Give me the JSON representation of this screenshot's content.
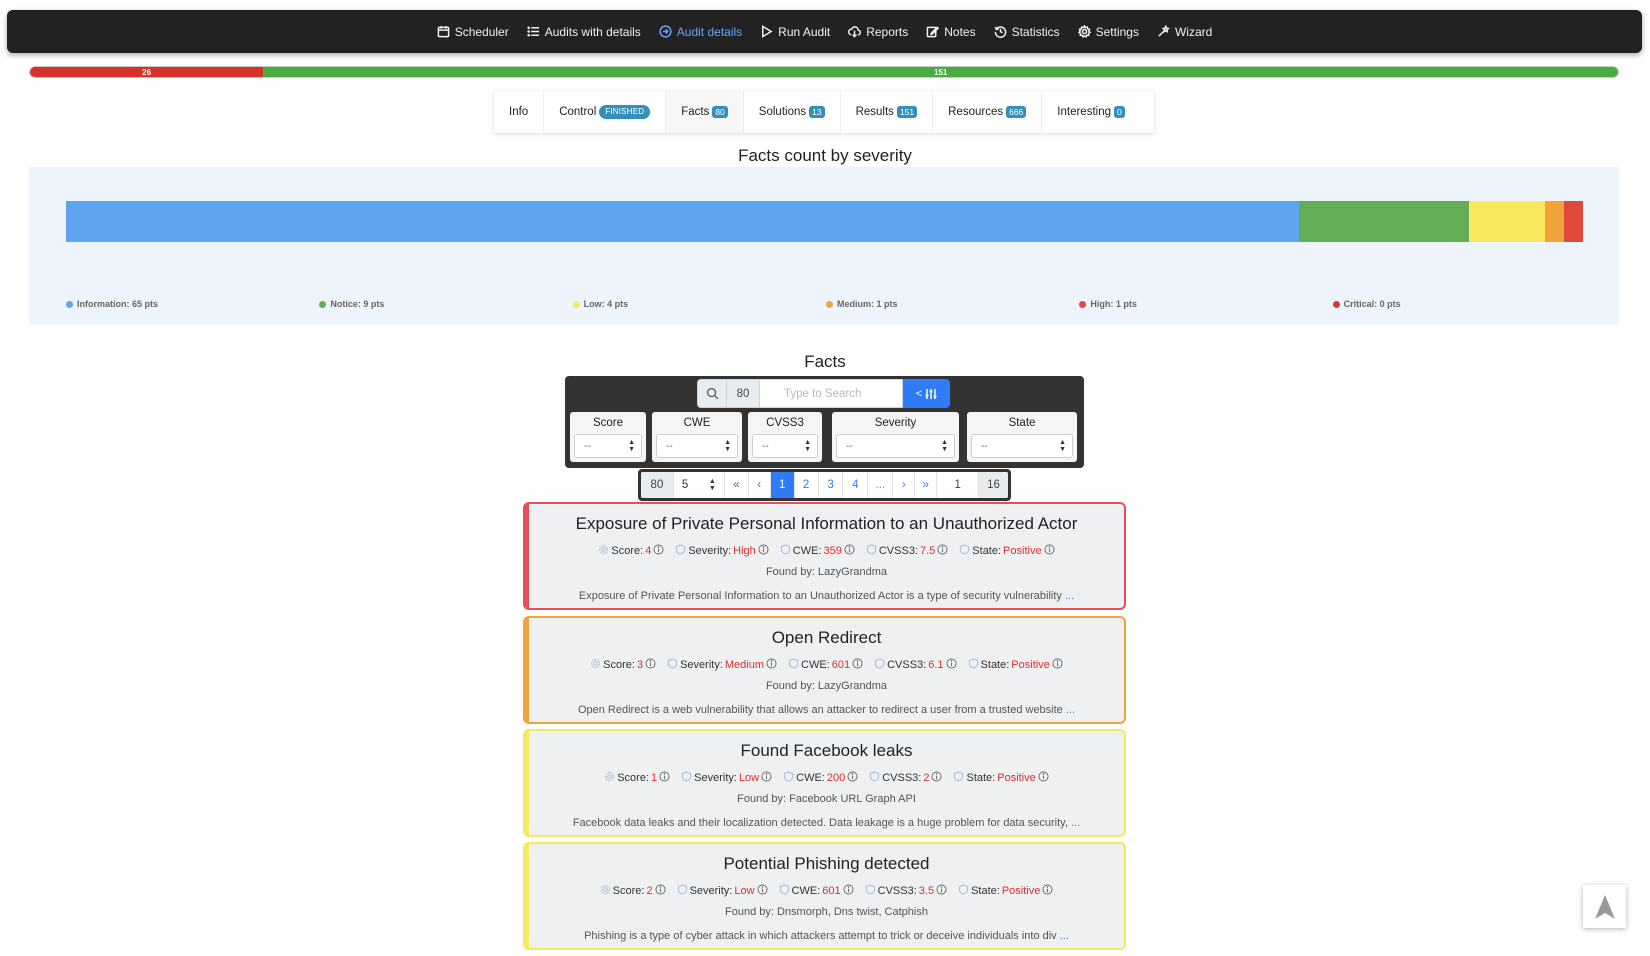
{
  "nav": [
    {
      "label": "Scheduler",
      "icon": "calendar-icon",
      "active": false
    },
    {
      "label": "Audits with details",
      "icon": "list-icon",
      "active": false
    },
    {
      "label": "Audit details",
      "icon": "arrow-circle-icon",
      "active": true
    },
    {
      "label": "Run Audit",
      "icon": "play-icon",
      "active": false
    },
    {
      "label": "Reports",
      "icon": "cloud-download-icon",
      "active": false
    },
    {
      "label": "Notes",
      "icon": "edit-icon",
      "active": false
    },
    {
      "label": "Statistics",
      "icon": "history-icon",
      "active": false
    },
    {
      "label": "Settings",
      "icon": "gear-icon",
      "active": false
    },
    {
      "label": "Wizard",
      "icon": "wand-icon",
      "active": false
    }
  ],
  "progress": {
    "segments": [
      {
        "label": "26",
        "value": 26,
        "color": "#d9302c"
      },
      {
        "label": "151",
        "value": 151,
        "color": "#4aab3f"
      }
    ]
  },
  "tabs": [
    {
      "label": "Info",
      "badge": "",
      "active": false
    },
    {
      "label": "Control",
      "badge": "FINISHED",
      "pill": true,
      "active": false
    },
    {
      "label": "Facts",
      "badge": "80",
      "active": true
    },
    {
      "label": "Solutions",
      "badge": "13",
      "active": false
    },
    {
      "label": "Results",
      "badge": "151",
      "active": false
    },
    {
      "label": "Resources",
      "badge": "666",
      "active": false
    },
    {
      "label": "Interesting",
      "badge": "0",
      "active": false
    }
  ],
  "chart_data": {
    "type": "bar",
    "title": "Facts count by severity",
    "orientation": "horizontal-stacked",
    "categories": [
      "Information",
      "Notice",
      "Low",
      "Medium",
      "High",
      "Critical"
    ],
    "values": [
      65,
      9,
      4,
      1,
      1,
      0
    ],
    "colors": [
      "#5ea3ee",
      "#62ad56",
      "#f7e85c",
      "#f0a33a",
      "#e0473d",
      "#cf3a33"
    ],
    "legend": [
      {
        "label": "Information: 65 pts"
      },
      {
        "label": "Notice: 9 pts"
      },
      {
        "label": "Low: 4 pts"
      },
      {
        "label": "Medium: 1 pts"
      },
      {
        "label": "High: 1 pts"
      },
      {
        "label": "Critical: 0 pts"
      }
    ],
    "legend_position": "bottom"
  },
  "facts": {
    "title": "Facts",
    "count": "80",
    "search_placeholder": "Type to Search",
    "toggle_label": "<",
    "filters": [
      {
        "label": "Score",
        "value": "--"
      },
      {
        "label": "CWE",
        "value": "--"
      },
      {
        "label": "CVSS3",
        "value": "--"
      },
      {
        "label": "Severity",
        "value": "--"
      },
      {
        "label": "State",
        "value": "--"
      }
    ]
  },
  "pagination": {
    "total": "80",
    "per_page": "5",
    "first": "«",
    "prev": "‹",
    "pages": [
      "1",
      "2",
      "3",
      "4",
      "..."
    ],
    "next": "›",
    "last": "»",
    "jump": "1",
    "page_count": "16"
  },
  "cards": [
    {
      "title": "Exposure of Private Personal Information to an Unauthorized Actor",
      "border_color": "#e5505a",
      "score": "4",
      "severity": "High",
      "cwe": "359",
      "cvss3": "7.5",
      "state": "Positive",
      "found_by": "Found by: LazyGrandma",
      "desc": "Exposure of Private Personal Information to an Unauthorized Actor is a type of security vulnerability",
      "more": "..."
    },
    {
      "title": "Open Redirect",
      "border_color": "#f0a33a",
      "score": "3",
      "severity": "Medium",
      "cwe": "601",
      "cvss3": "6.1",
      "state": "Positive",
      "found_by": "Found by: LazyGrandma",
      "desc": "Open Redirect is a web vulnerability that allows an attacker to redirect a user from a trusted website",
      "more": "..."
    },
    {
      "title": "Found Facebook leaks",
      "border_color": "#f7e85c",
      "score": "1",
      "severity": "Low",
      "cwe": "200",
      "cvss3": "2",
      "state": "Positive",
      "found_by": "Found by: Facebook URL Graph API",
      "desc": "Facebook data leaks and their localization detected. Data leakage is a huge problem for data security,",
      "more": "..."
    },
    {
      "title": "Potential Phishing detected",
      "border_color": "#f7e85c",
      "score": "2",
      "severity": "Low",
      "cwe": "601",
      "cvss3": "3.5",
      "state": "Positive",
      "found_by": "Found by: Dnsmorph, Dns twist, Catphish",
      "desc": "Phishing is a type of cyber attack in which attackers attempt to trick or deceive individuals into div",
      "more": "..."
    }
  ],
  "meta_labels": {
    "score": "Score:",
    "severity": "Severity:",
    "cwe": "CWE:",
    "cvss3": "CVSS3:",
    "state": "State:"
  }
}
